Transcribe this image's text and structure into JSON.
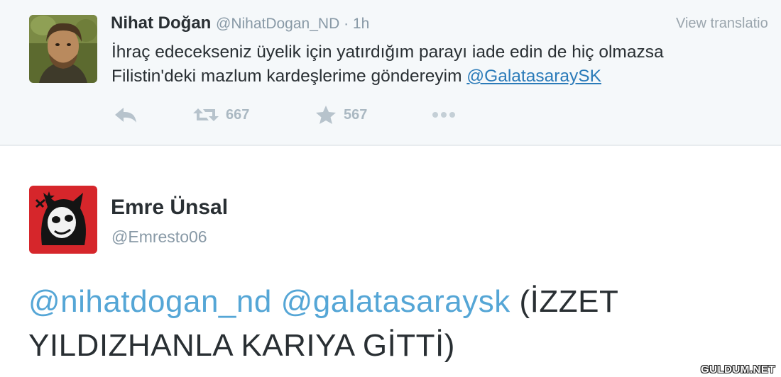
{
  "tweet1": {
    "author_name": "Nihat Doğan",
    "handle": "@NihatDogan_ND",
    "separator": " · ",
    "time": "1h",
    "view_translation": "View translatio",
    "text_line1": "İhraç edecekseniz üyelik için yatırdığım parayı iade edin de hiç olmazsa",
    "text_line2": "Filistin'deki mazlum kardeşlerime göndereyim ",
    "mention": "@GalatasaraySK",
    "actions": {
      "reply_icon": "reply-icon",
      "retweet_icon": "retweet-icon",
      "retweet_count": "667",
      "favorite_icon": "star-icon",
      "favorite_count": "567",
      "more_icon": "more-dots-icon"
    }
  },
  "tweet2": {
    "author_name": "Emre Ünsal",
    "handle": "@Emresto06",
    "mention1": "@nihatdogan_nd",
    "mention2": "@galatasaraysk",
    "text": "(İZZET YILDIZHANLA KARIYA GİTTİ)"
  },
  "watermark": "GULDUM.NET",
  "colors": {
    "link": "#2b7bb9",
    "mention_large": "#55a6d6",
    "text": "#292f33",
    "muted": "#8899a6",
    "top_background": "#f5f8fa"
  }
}
